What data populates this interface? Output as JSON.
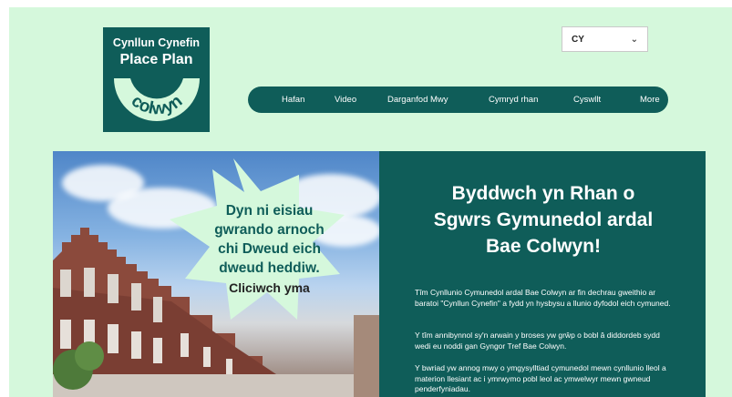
{
  "logo": {
    "line1": "Cynllun Cynefin",
    "line2": "Place Plan",
    "mark": "colwyn"
  },
  "language": {
    "selected": "CY",
    "icon": "chevron-down-icon"
  },
  "nav": {
    "items": [
      "Hafan",
      "Video",
      "Darganfod Mwy",
      "Cymryd rhan",
      "Cyswllt",
      "More"
    ]
  },
  "hero": {
    "star_lines": [
      "Dyn ni eisiau",
      "gwrando arnoch",
      "chi Dweud eich",
      "dweud heddiw."
    ],
    "cta": "Cliciwch yma"
  },
  "panel": {
    "heading_lines": [
      "Byddwch yn Rhan o",
      "Sgwrs Gymunedol ardal",
      "Bae Colwyn!"
    ],
    "paragraphs": [
      "Tîm Cynllunio Cymunedol ardal Bae Colwyn ar fin dechrau gweithio ar baratoi \"Cynllun Cynefin\" a fydd yn hysbysu a llunio dyfodol eich cymuned.",
      "Y tîm annibynnol sy'n arwain y broses yw grŵp o bobl â diddordeb sydd wedi eu noddi gan Gyngor Tref Bae Colwyn.",
      "Y bwriad yw annog mwy o ymgysylltiad cymunedol mewn cynllunio lleol a materion llesiant ac i ymrwymo pobl leol ac ymwelwyr mewn gwneud penderfyniadau."
    ]
  },
  "colors": {
    "brand": "#0f5d59",
    "background": "#d5f8dc",
    "star": "#d5f8dc"
  }
}
